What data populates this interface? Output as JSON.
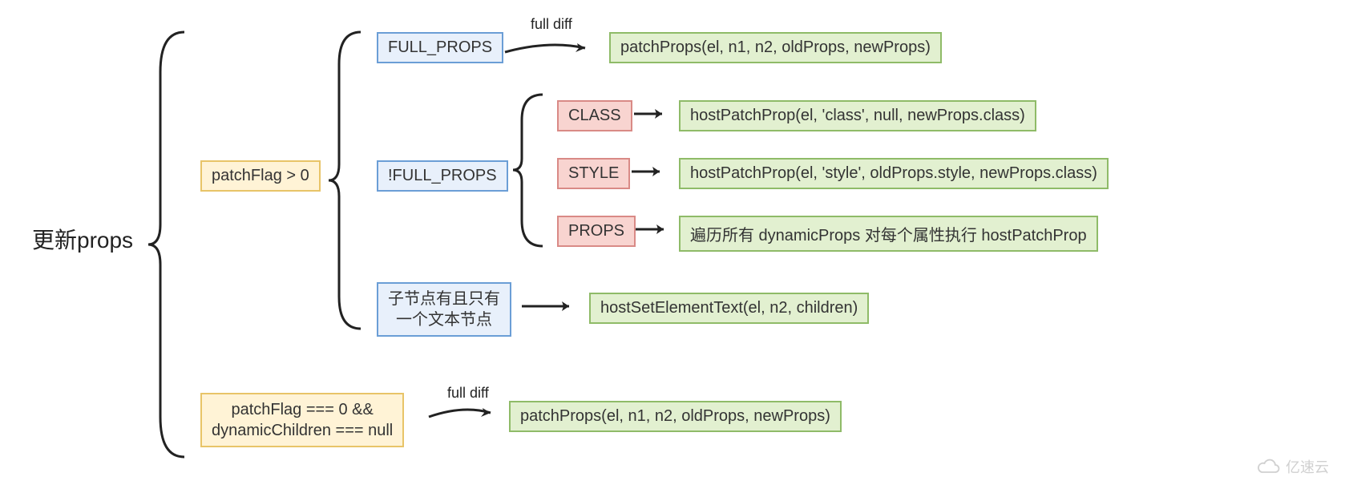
{
  "root": "更新props",
  "branch_a": {
    "condition": "patchFlag > 0",
    "child_full": {
      "label": "FULL_PROPS",
      "arrow_label": "full diff",
      "result": "patchProps(el, n1, n2, oldProps, newProps)"
    },
    "child_notfull": {
      "label": "!FULL_PROPS",
      "class": {
        "tag": "CLASS",
        "result": "hostPatchProp(el, 'class', null, newProps.class)"
      },
      "style": {
        "tag": "STYLE",
        "result": "hostPatchProp(el, 'style', oldProps.style, newProps.class)"
      },
      "props": {
        "tag": "PROPS",
        "result": "遍历所有 dynamicProps 对每个属性执行 hostPatchProp"
      }
    },
    "child_text": {
      "label_line1": "子节点有且只有",
      "label_line2": "一个文本节点",
      "result": "hostSetElementText(el, n2, children)"
    }
  },
  "branch_b": {
    "condition_line1": "patchFlag === 0  &&",
    "condition_line2": "dynamicChildren === null",
    "arrow_label": "full diff",
    "result": "patchProps(el, n1, n2, oldProps, newProps)"
  },
  "watermark": "亿速云"
}
